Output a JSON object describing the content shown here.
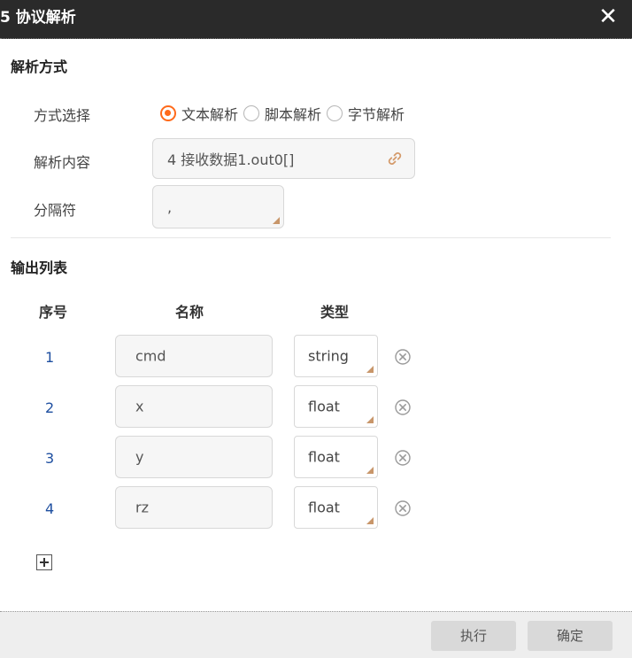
{
  "window": {
    "title": "5 协议解析",
    "close_label": "✕"
  },
  "parse_section": {
    "title": "解析方式",
    "mode_label": "方式选择",
    "modes": [
      {
        "label": "文本解析",
        "checked": true
      },
      {
        "label": "脚本解析",
        "checked": false
      },
      {
        "label": "字节解析",
        "checked": false
      }
    ],
    "content_label": "解析内容",
    "content_value": "4 接收数据1.out0[]",
    "separator_label": "分隔符",
    "separator_value": ","
  },
  "output_section": {
    "title": "输出列表",
    "columns": [
      "序号",
      "名称",
      "类型"
    ],
    "rows": [
      {
        "index": "1",
        "name": "cmd",
        "type": "string"
      },
      {
        "index": "2",
        "name": "x",
        "type": "float"
      },
      {
        "index": "3",
        "name": "y",
        "type": "float"
      },
      {
        "index": "4",
        "name": "rz",
        "type": "float"
      }
    ]
  },
  "footer": {
    "execute_label": "执行",
    "confirm_label": "确定"
  },
  "colors": {
    "accent": "#ff6a1a",
    "titlebar": "#2a2a2a",
    "index_text": "#1e4fa0"
  },
  "icons": {
    "close": "close-icon",
    "link": "link-icon",
    "delete": "delete-row-icon",
    "add": "plus-icon"
  }
}
